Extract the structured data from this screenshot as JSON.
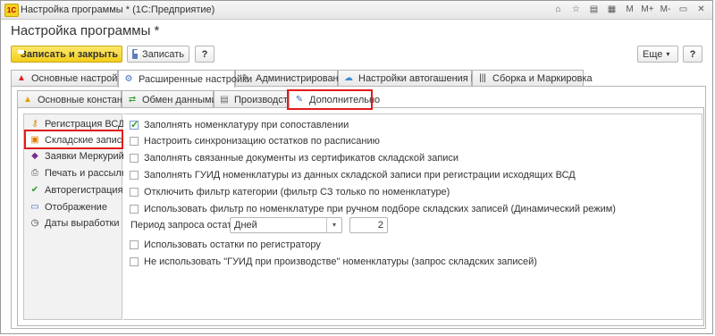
{
  "window": {
    "title": "Настройка программы * (1С:Предприятие)",
    "logo": "1С"
  },
  "page_title": "Настройка программы *",
  "toolbar": {
    "save_close": "Записать и закрыть",
    "save": "Записать",
    "help": "?",
    "more": "Еще",
    "help2": "?"
  },
  "top_tabs": [
    {
      "label": "Основные настройки",
      "icon": "warning-icon"
    },
    {
      "label": "Расширенные настройки",
      "icon": "gear-icon"
    },
    {
      "label": "Администрирование",
      "icon": "wrench-icon"
    },
    {
      "label": "Настройки автогашения ВСД",
      "icon": "cloud-icon"
    },
    {
      "label": "Сборка и Маркировка",
      "icon": "barcode-icon"
    }
  ],
  "sub_tabs": [
    {
      "label": "Основные константы",
      "icon": "warning-icon"
    },
    {
      "label": "Обмен данными",
      "icon": "sync-icon"
    },
    {
      "label": "Производство",
      "icon": "document-icon"
    },
    {
      "label": "Дополнительно",
      "icon": "tools-icon"
    }
  ],
  "side_nav": [
    {
      "label": "Регистрация ВСД",
      "icon": "key-icon"
    },
    {
      "label": "Складские записи",
      "icon": "boxes-icon"
    },
    {
      "label": "Заявки Меркурий",
      "icon": "cube-icon"
    },
    {
      "label": "Печать и рассылка",
      "icon": "printer-icon"
    },
    {
      "label": "Авторегистрация",
      "icon": "check-badge-icon"
    },
    {
      "label": "Отображение",
      "icon": "monitor-icon"
    },
    {
      "label": "Даты выработки",
      "icon": "clock-icon"
    }
  ],
  "options": [
    {
      "label": "Заполнять номенклатуру при сопоставлении",
      "checked": true
    },
    {
      "label": "Настроить синхронизацию остатков по расписанию",
      "checked": false
    },
    {
      "label": "Заполнять связанные документы из сертификатов складской записи",
      "checked": false
    },
    {
      "label": "Заполнять ГУИД номенклатуры из данных складской записи при регистрации исходящих ВСД",
      "checked": false
    },
    {
      "label": "Отключить фильтр категории (фильтр СЗ только по номенклатуре)",
      "checked": false
    },
    {
      "label": "Использовать фильтр по номенклатуре при ручном подборе складских записей (Динамический режим)",
      "checked": false
    }
  ],
  "period": {
    "label": "Период запроса остатков:",
    "unit": "Дней",
    "value": "2"
  },
  "options2": [
    {
      "label": "Использовать остатки по регистратору",
      "checked": false
    },
    {
      "label": "Не использовать \"ГУИД при производстве\" номенклатуры (запрос складских записей)",
      "checked": false
    }
  ],
  "colors": {
    "highlight": "#e31b1b",
    "primary_button": "#f3ce1b"
  }
}
